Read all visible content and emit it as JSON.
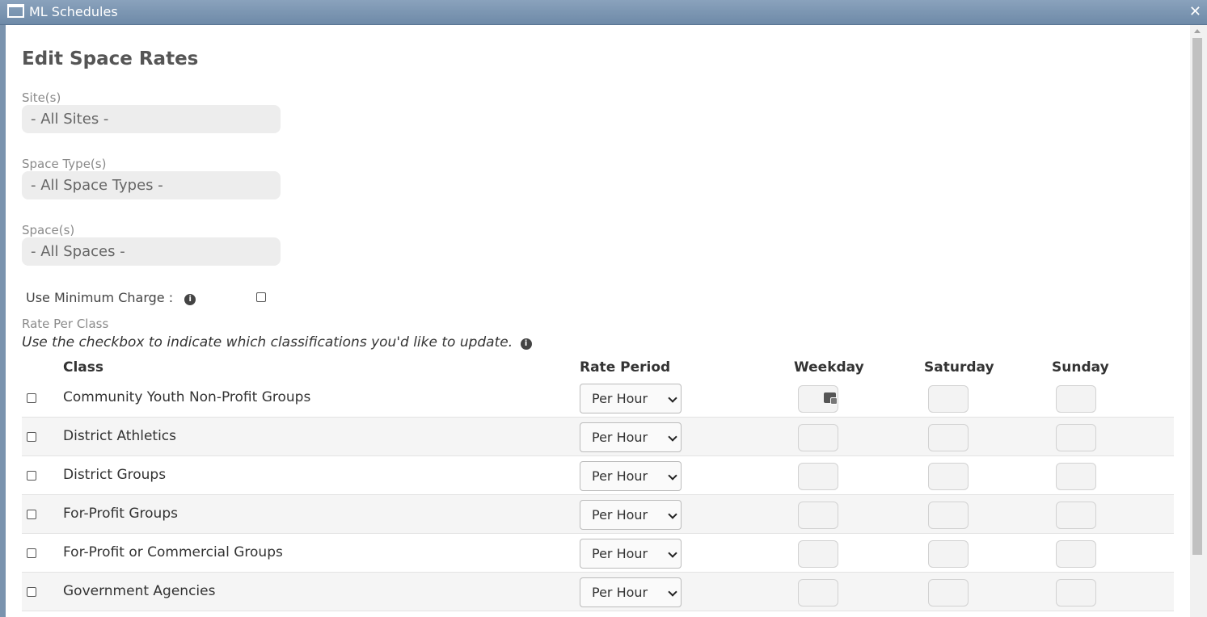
{
  "window": {
    "title": "ML Schedules",
    "close_label": "✕"
  },
  "page": {
    "heading": "Edit Space Rates"
  },
  "filters": [
    {
      "label": "Site(s)",
      "value": "- All Sites -"
    },
    {
      "label": "Space Type(s)",
      "value": "- All Space Types -"
    },
    {
      "label": "Space(s)",
      "value": "- All Spaces -"
    }
  ],
  "minimum_charge": {
    "label": "Use Minimum Charge :",
    "checked": false
  },
  "rates": {
    "section_label": "Rate Per Class",
    "instruction": "Use the checkbox to indicate which classifications you'd like to update.",
    "columns": {
      "class": "Class",
      "rate_period": "Rate Period",
      "weekday": "Weekday",
      "saturday": "Saturday",
      "sunday": "Sunday"
    },
    "rows": [
      {
        "class": "Community Youth Non-Profit Groups",
        "period": "Per Hour"
      },
      {
        "class": "District Athletics",
        "period": "Per Hour"
      },
      {
        "class": "District Groups",
        "period": "Per Hour"
      },
      {
        "class": "For-Profit Groups",
        "period": "Per Hour"
      },
      {
        "class": "For-Profit or Commercial Groups",
        "period": "Per Hour"
      },
      {
        "class": "Government Agencies",
        "period": "Per Hour"
      }
    ]
  }
}
